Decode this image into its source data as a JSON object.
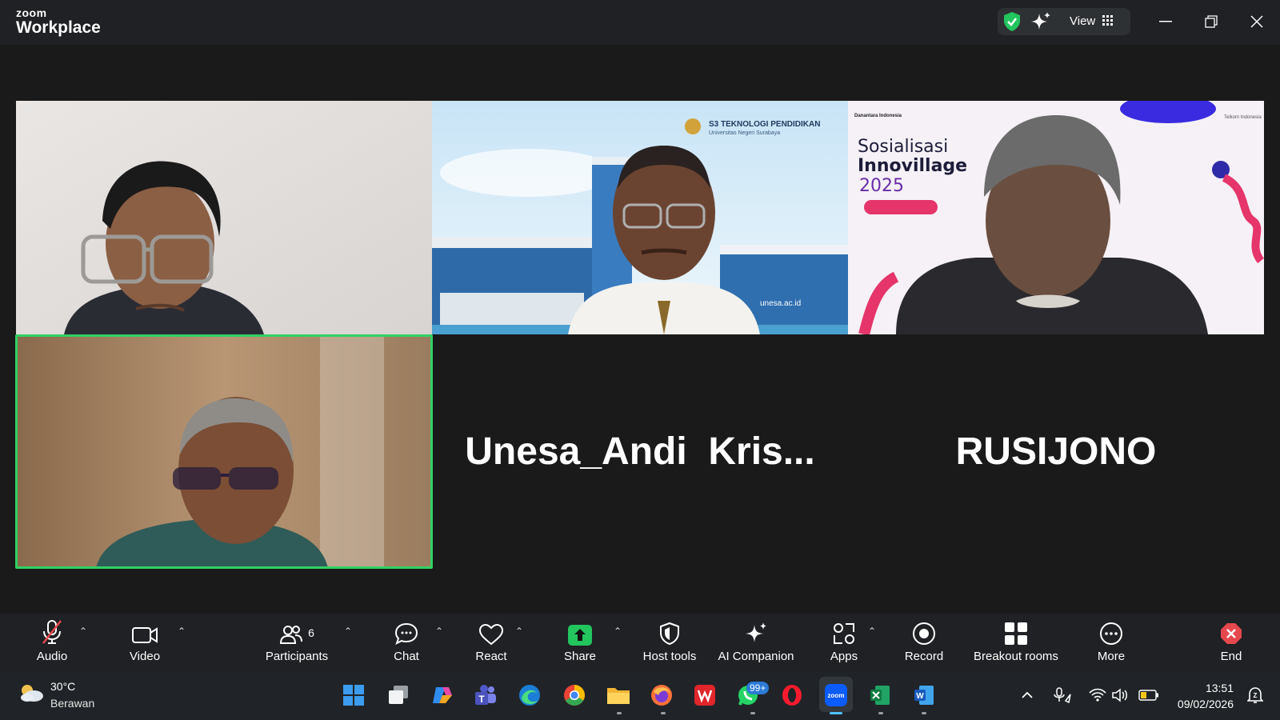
{
  "app": {
    "brand_top": "zoom",
    "brand_bottom": "Workplace"
  },
  "titlebar": {
    "view_label": "View"
  },
  "participants": {
    "name_tile_1": "Unesa_Andi  Kris...",
    "name_tile_2": "RUSIJONO"
  },
  "video_backgrounds": {
    "tile2_title": "S3 TEKNOLOGI PENDIDIKAN",
    "tile2_subtitle": "Universitas Negeri Surabaya",
    "tile2_url": "unesa.ac.id",
    "tile3_title_1": "Sosialisasi",
    "tile3_title_2": "Innovillage",
    "tile3_year": "2025",
    "tile3_brand": "Danantara Indonesia",
    "tile3_sponsor": "Telkom Indonesia"
  },
  "toolbar": {
    "audio": "Audio",
    "video": "Video",
    "participants": "Participants",
    "participants_count": "6",
    "chat": "Chat",
    "react": "React",
    "share": "Share",
    "host_tools": "Host tools",
    "ai_companion": "AI Companion",
    "apps": "Apps",
    "record": "Record",
    "breakout_rooms": "Breakout rooms",
    "more": "More",
    "end": "End"
  },
  "taskbar": {
    "temperature": "30°C",
    "weather": "Berawan",
    "whatsapp_badge": "99+",
    "time": "13:51",
    "date": "09/02/2026"
  },
  "colors": {
    "active_speaker": "#2fd165",
    "share_green": "#22c55e",
    "end_red": "#e5484d"
  }
}
